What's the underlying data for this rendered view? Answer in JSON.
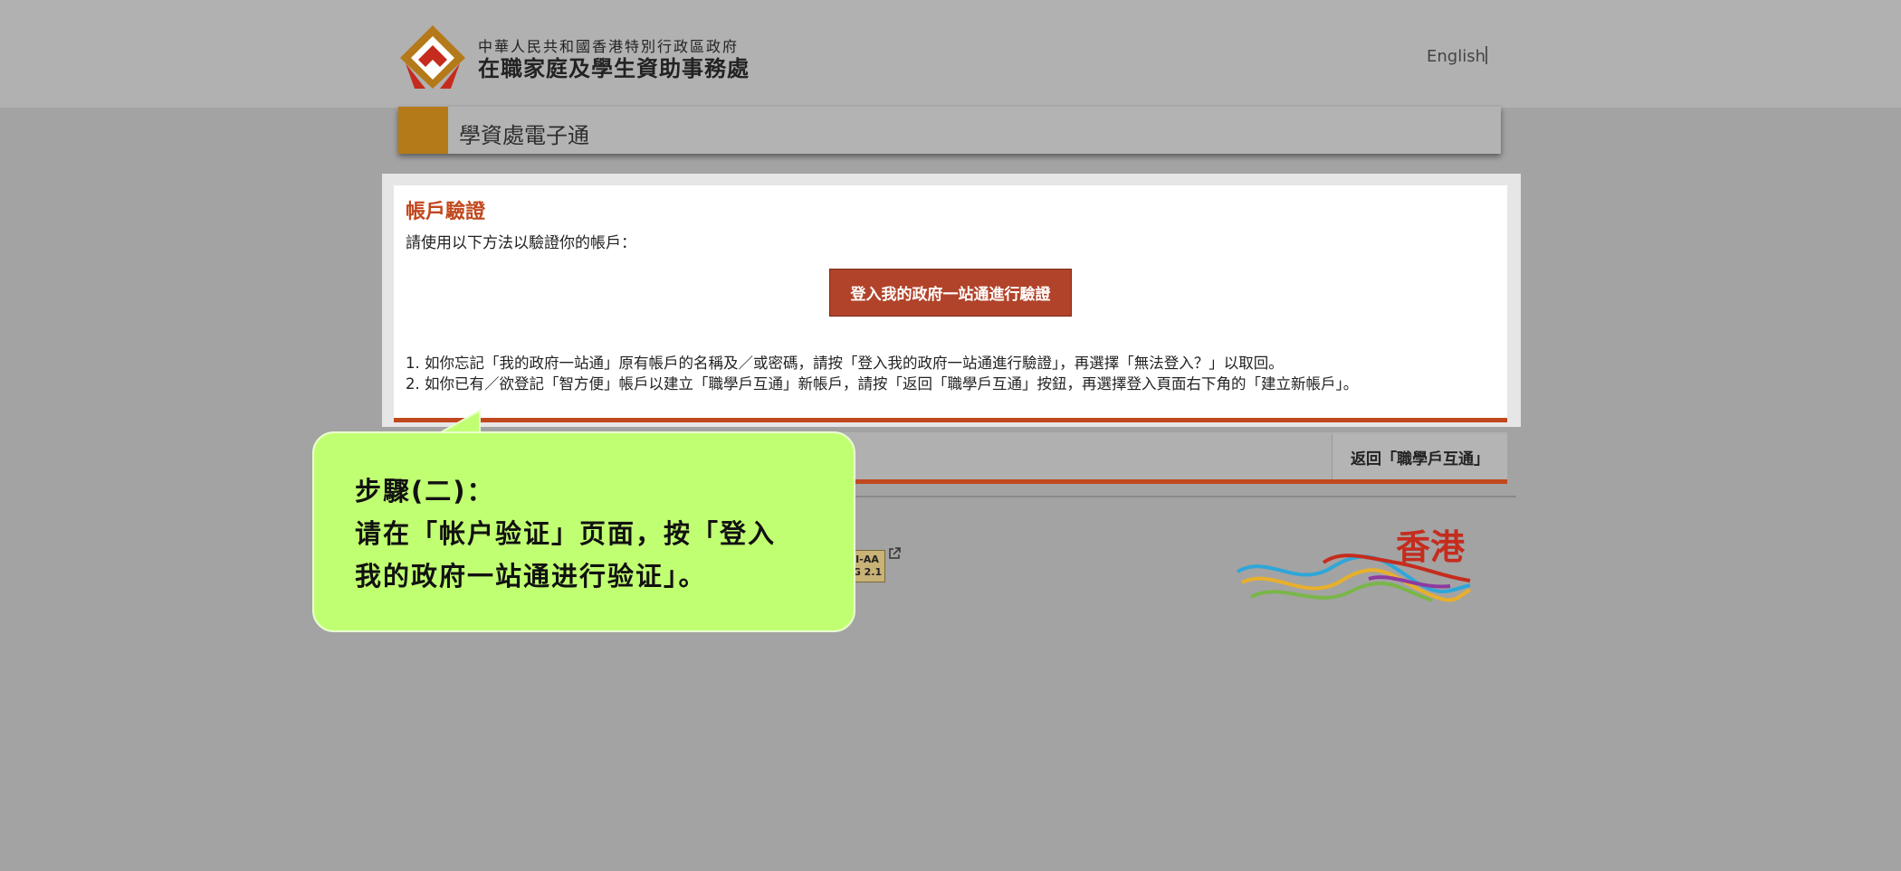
{
  "header": {
    "org_line1": "中華人民共和國香港特別行政區政府",
    "org_line2": "在職家庭及學生資助事務處",
    "lang_link": "English",
    "logo_icon": "wfsfaa-logo-icon"
  },
  "title_bar": {
    "title": "學資處電子通"
  },
  "card": {
    "title": "帳戶驗證",
    "subtitle": "請使用以下方法以驗證你的帳戶：",
    "login_button": "登入我的政府一站通進行驗證",
    "notes": [
      "1. 如你忘記「我的政府一站通」原有帳戶的名稱及／或密碼，請按「登入我的政府一站通進行驗證」，再選擇「無法登入？」以取回。",
      "2. 如你已有／欲登記「智方便」帳戶以建立「職學戶互通」新帳戶，請按「返回「職學戶互通」按鈕，再選擇登入頁面右下角的「建立新帳戶」。"
    ]
  },
  "back_button": "返回「職學戶互通」",
  "footer": {
    "wcag_badge_line1": "I-AA",
    "wcag_badge_line2": "G 2.1",
    "brand_text": "香港"
  },
  "callout": {
    "line1": "步驟(二)：",
    "line2": "请在「帐户验证」页面，按「登入",
    "line3": "我的政府一站通进行验证」。"
  },
  "colors": {
    "accent_gold": "#b47a19",
    "accent_red": "#c1481e",
    "button_red": "#b1432a",
    "callout_green": "#c1ff72"
  }
}
